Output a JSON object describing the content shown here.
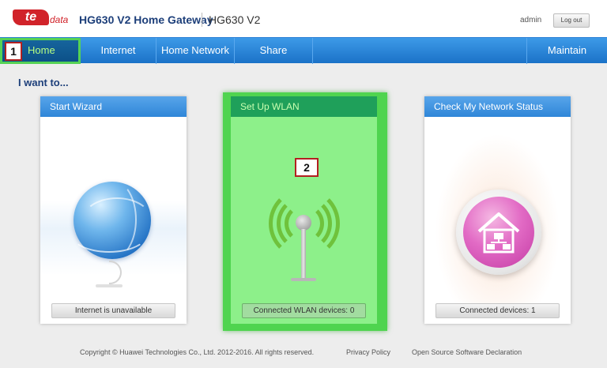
{
  "header": {
    "logo_te": "te",
    "logo_data": "data",
    "product_title": "HG630 V2 Home Gateway",
    "product_model": "HG630 V2",
    "user": "admin",
    "logout_label": "Log out"
  },
  "nav": {
    "items": [
      {
        "label": "Home",
        "active": true
      },
      {
        "label": "Internet"
      },
      {
        "label": "Home Network"
      },
      {
        "label": "Share"
      },
      {
        "label": "Maintain"
      }
    ]
  },
  "markers": [
    "1",
    "2"
  ],
  "section_title": "I want to...",
  "cards": [
    {
      "title": "Start Wizard",
      "status": "Internet is unavailable",
      "icon": "globe-icon"
    },
    {
      "title": "Set Up WLAN",
      "status": "Connected WLAN devices: 0",
      "icon": "wifi-antenna-icon"
    },
    {
      "title": "Check My Network Status",
      "status": "Connected devices: 1",
      "icon": "home-network-icon"
    }
  ],
  "footer": {
    "copyright": "Copyright © Huawei Technologies Co., Ltd. 2012-2016. All rights reserved.",
    "privacy": "Privacy Policy",
    "oss": "Open Source Software Declaration"
  },
  "colors": {
    "nav_blue": "#2a84d8",
    "brand_red": "#d1232a",
    "highlight_green": "#4fd44f",
    "marker_border": "#b32020"
  }
}
